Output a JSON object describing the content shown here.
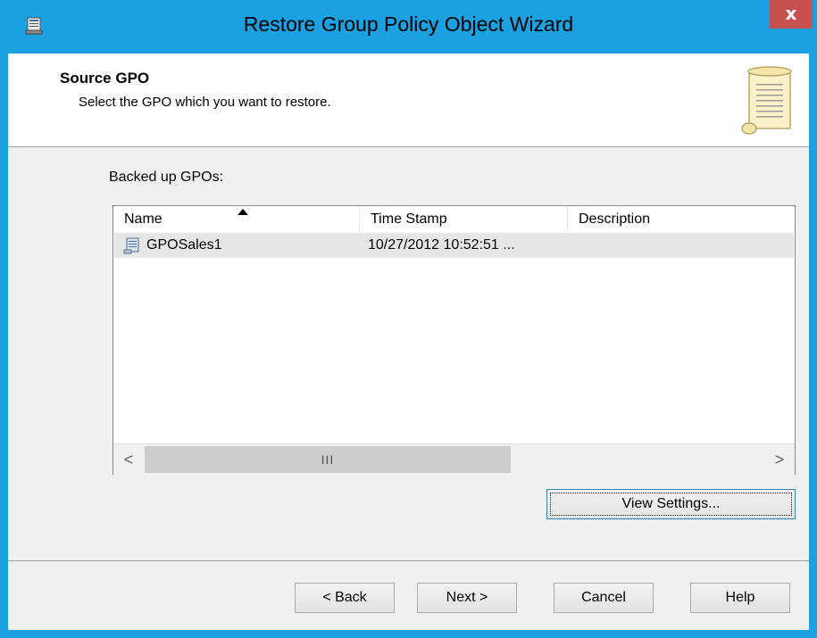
{
  "window": {
    "title": "Restore Group Policy Object Wizard",
    "close_glyph": "x"
  },
  "header": {
    "title": "Source GPO",
    "subtitle": "Select the GPO which you want to restore."
  },
  "list": {
    "label": "Backed up GPOs:",
    "columns": [
      "Name",
      "Time Stamp",
      "Description"
    ],
    "sort_column": "Name",
    "rows": [
      {
        "name": "GPOSales1",
        "time_stamp": "10/27/2012 10:52:51 ...",
        "description": ""
      }
    ],
    "scroll_left": "<",
    "scroll_right": ">",
    "scroll_grip": "III"
  },
  "buttons": {
    "view_settings": "View Settings...",
    "back": "< Back",
    "next": "Next >",
    "cancel": "Cancel",
    "help": "Help"
  },
  "colors": {
    "titlebar": "#1ba1e2",
    "close": "#c75050",
    "selection_row": "#e6e6e6"
  }
}
